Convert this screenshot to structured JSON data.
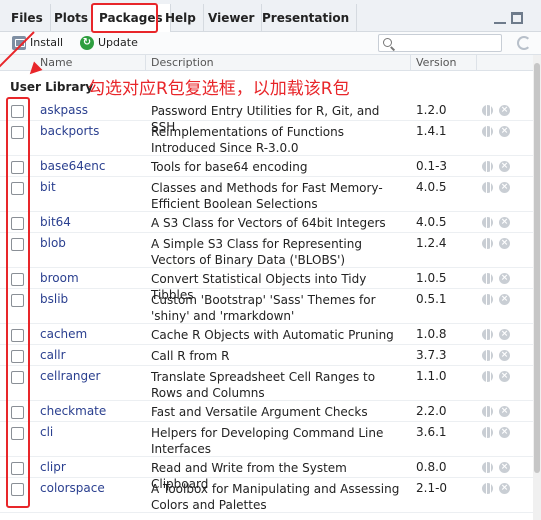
{
  "tabs": [
    "Files",
    "Plots",
    "Packages",
    "Help",
    "Viewer",
    "Presentation"
  ],
  "toolbar": {
    "install_label": "Install",
    "update_label": "Update",
    "search_placeholder": ""
  },
  "table": {
    "headers": {
      "name": "Name",
      "description": "Description",
      "version": "Version"
    },
    "section": "User Library",
    "rows": [
      {
        "name": "askpass",
        "description": "Password Entry Utilities for R, Git, and SSH",
        "version": "1.2.0",
        "checked": false
      },
      {
        "name": "backports",
        "description": "Reimplementations of Functions Introduced Since R-3.0.0",
        "version": "1.4.1",
        "checked": false
      },
      {
        "name": "base64enc",
        "description": "Tools for base64 encoding",
        "version": "0.1-3",
        "checked": false
      },
      {
        "name": "bit",
        "description": "Classes and Methods for Fast Memory-Efficient Boolean Selections",
        "version": "4.0.5",
        "checked": false
      },
      {
        "name": "bit64",
        "description": "A S3 Class for Vectors of 64bit Integers",
        "version": "4.0.5",
        "checked": false
      },
      {
        "name": "blob",
        "description": "A Simple S3 Class for Representing Vectors of Binary Data ('BLOBS')",
        "version": "1.2.4",
        "checked": false
      },
      {
        "name": "broom",
        "description": "Convert Statistical Objects into Tidy Tibbles",
        "version": "1.0.5",
        "checked": false
      },
      {
        "name": "bslib",
        "description": "Custom 'Bootstrap' 'Sass' Themes for 'shiny' and 'rmarkdown'",
        "version": "0.5.1",
        "checked": false
      },
      {
        "name": "cachem",
        "description": "Cache R Objects with Automatic Pruning",
        "version": "1.0.8",
        "checked": false
      },
      {
        "name": "callr",
        "description": "Call R from R",
        "version": "3.7.3",
        "checked": false
      },
      {
        "name": "cellranger",
        "description": "Translate Spreadsheet Cell Ranges to Rows and Columns",
        "version": "1.1.0",
        "checked": false
      },
      {
        "name": "checkmate",
        "description": "Fast and Versatile Argument Checks",
        "version": "2.2.0",
        "checked": false
      },
      {
        "name": "cli",
        "description": "Helpers for Developing Command Line Interfaces",
        "version": "3.6.1",
        "checked": false
      },
      {
        "name": "clipr",
        "description": "Read and Write from the System Clipboard",
        "version": "0.8.0",
        "checked": false
      },
      {
        "name": "colorspace",
        "description": "A Toolbox for Manipulating and Assessing Colors and Palettes",
        "version": "2.1-0",
        "checked": false
      }
    ]
  },
  "annotation": {
    "text": "勾选对应R包复选框，以加载该R包",
    "color": "#e8262a"
  }
}
